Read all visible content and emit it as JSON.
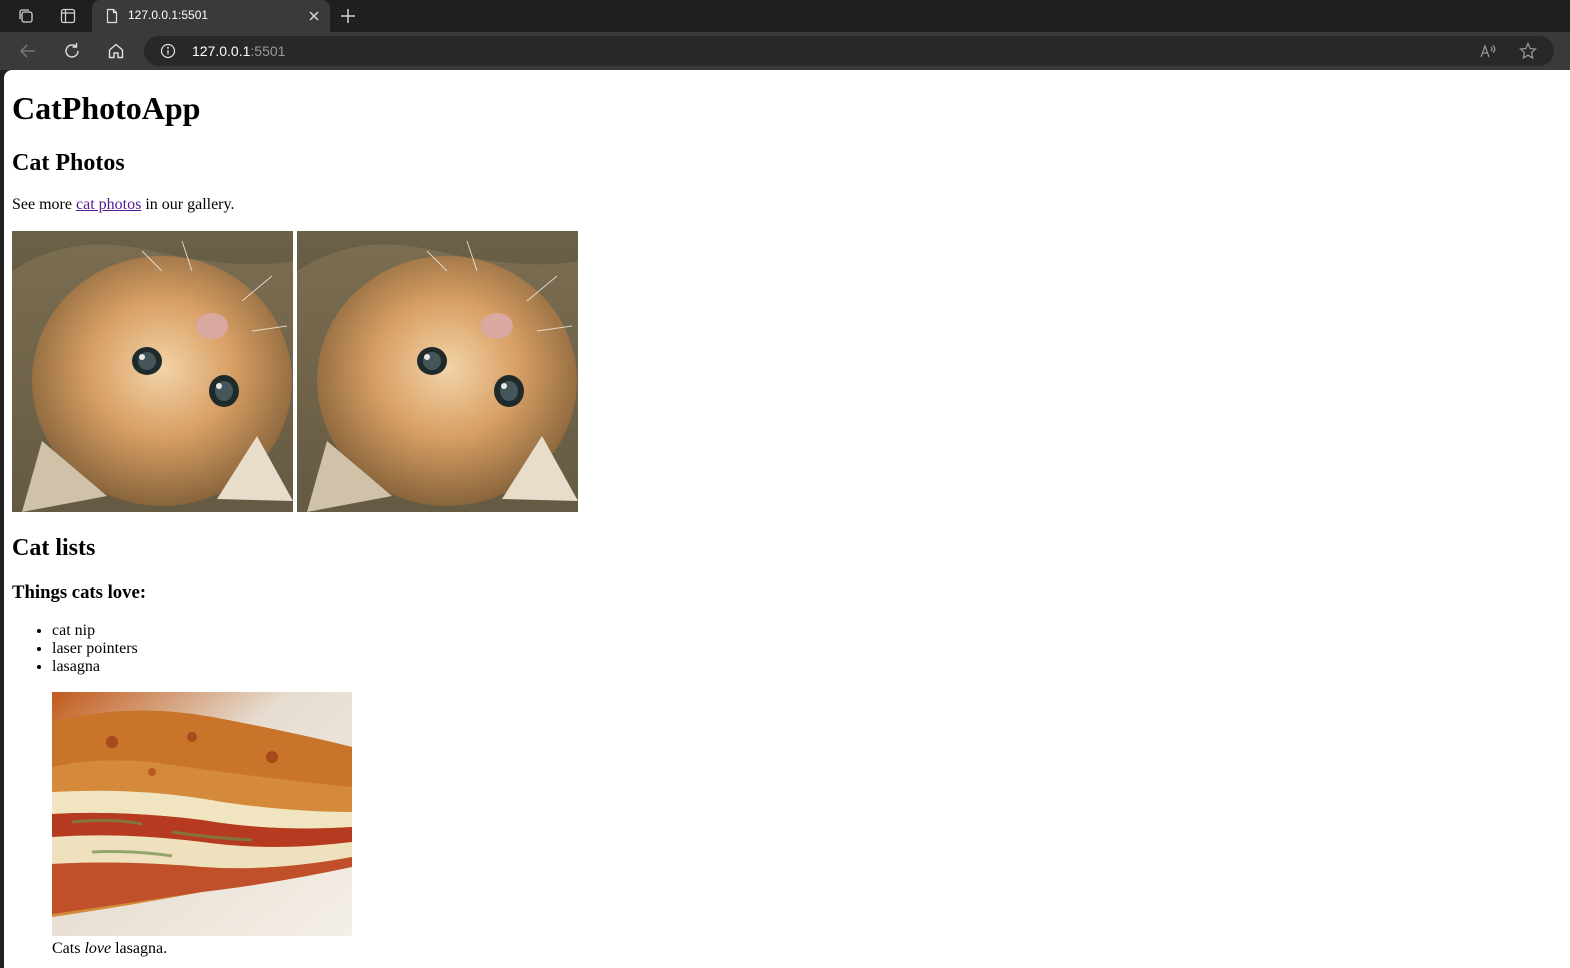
{
  "browser": {
    "tab": {
      "title": "127.0.0.1:5501"
    },
    "address": {
      "host": "127.0.0.1",
      "port": ":5501"
    },
    "icons": {
      "workspaces": "workspaces-icon",
      "tab_actions": "tab-actions-icon",
      "favicon": "page-icon",
      "close": "close-icon",
      "new_tab": "plus-icon",
      "back": "back-arrow-icon",
      "refresh": "refresh-icon",
      "home": "home-icon",
      "info": "info-icon",
      "read_aloud": "read-aloud-icon",
      "favorite": "star-icon"
    },
    "colors": {
      "tabstrip": "#1f1f1f",
      "toolbar": "#3a3a3a",
      "omnibox": "#282828"
    }
  },
  "page": {
    "title": "CatPhotoApp",
    "section1_heading": "Cat Photos",
    "gallery_text_before": "See more ",
    "gallery_link": "cat photos",
    "gallery_text_after": " in our gallery.",
    "section2_heading": "Cat lists",
    "list_heading": "Things cats love:",
    "list_items": [
      "cat nip",
      "laser pointers",
      "lasagna"
    ],
    "caption_before": "Cats ",
    "caption_em": "love",
    "caption_after": " lasagna.",
    "colors": {
      "visited_link": "#551a8b"
    }
  }
}
